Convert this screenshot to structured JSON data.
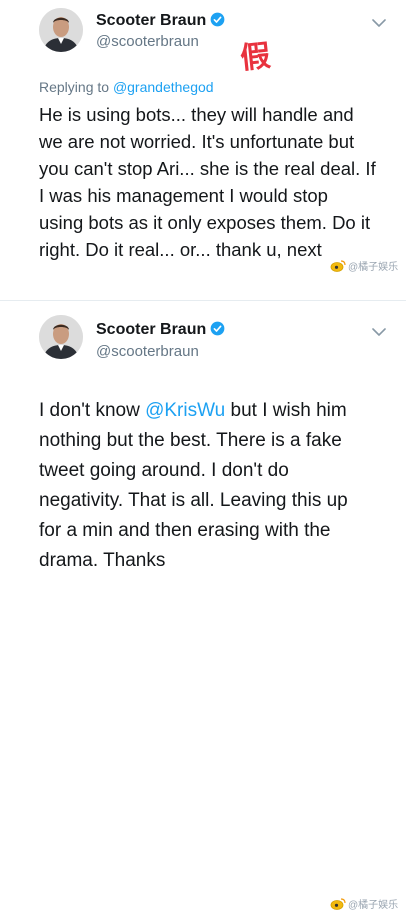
{
  "tweets": [
    {
      "author": {
        "display_name": "Scooter Braun",
        "handle": "@scooterbraun",
        "verified": true
      },
      "replying_to": {
        "prefix": "Replying to",
        "mention": "@grandethegod"
      },
      "text": "He is using bots... they will handle and\nwe are not worried. It's unfortunate but\nyou can't stop Ari... she is the real deal. If\nI was his management I would stop\nusing bots as it only exposes them. Do it\nright. Do it real... or... thank u, next",
      "overlay_stamp": "假",
      "icons": [
        "verified-badge-icon",
        "chevron-down-icon"
      ]
    },
    {
      "author": {
        "display_name": "Scooter Braun",
        "handle": "@scooterbraun",
        "verified": true
      },
      "text_before_mention": "I don't know ",
      "mention": "@KrisWu",
      "text_after_mention": " but I wish him\nnothing but the best. There is a fake\ntweet going around. I don't do\nnegativity. That is all. Leaving this up\nfor a min and then erasing with the\ndrama. Thanks",
      "icons": [
        "verified-badge-icon",
        "chevron-down-icon"
      ]
    }
  ],
  "watermarks": [
    "@橘子娱乐",
    "@橘子娱乐"
  ],
  "colors": {
    "link": "#1da1f2",
    "secondary_text": "#657786",
    "primary_text": "#14171a",
    "stamp_red": "#e8323e",
    "divider": "#e6ecf0"
  }
}
